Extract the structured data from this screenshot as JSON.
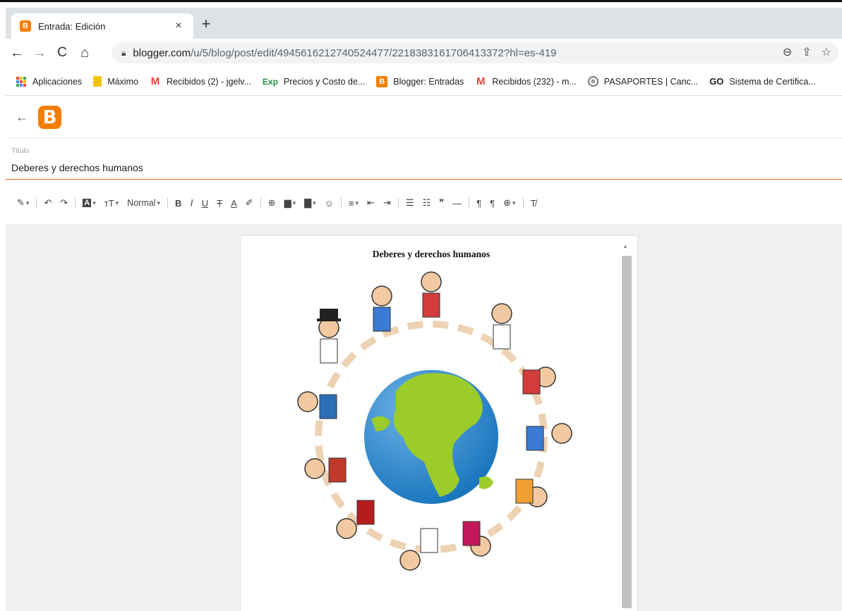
{
  "browser": {
    "tab": {
      "title": "Entrada: Edición",
      "favicon_letter": "B",
      "close": "×"
    },
    "new_tab": "+",
    "nav": {
      "back": "←",
      "forward": "→",
      "reload": "C",
      "home": "⌂"
    },
    "url": {
      "host": "blogger.com",
      "path": "/u/5/blog/post/edit/4945616212740524477/2218383161706413372?hl=es-419"
    },
    "omni_icons": {
      "zoom": "⊖",
      "share": "⇪",
      "star": "☆"
    }
  },
  "bookmarks": [
    {
      "icon": "apps-icon",
      "label": "Aplicaciones"
    },
    {
      "icon": "doc-icon",
      "label": "Máximo"
    },
    {
      "icon": "gmail-icon",
      "glyph": "M",
      "label": "Recibidos (2) - jgelv..."
    },
    {
      "icon": "exp-icon",
      "glyph": "Exp",
      "label": "Precios y Costo de..."
    },
    {
      "icon": "blogger-icon",
      "glyph": "B",
      "label": "Blogger: Entradas"
    },
    {
      "icon": "gmail-icon",
      "glyph": "M",
      "label": "Recibidos (232) - m..."
    },
    {
      "icon": "seal-icon",
      "glyph": "⊛",
      "label": "PASAPORTES | Canc..."
    },
    {
      "icon": "go-icon",
      "glyph": "GO",
      "label": "Sistema de Certifica..."
    }
  ],
  "app": {
    "back": "←",
    "logo_letter": "B",
    "title_label": "Título",
    "title_value": "Deberes y derechos humanos"
  },
  "format_bar": {
    "pen": "✎",
    "undo": "↶",
    "redo": "↷",
    "text_style": "A",
    "font_size": "тT",
    "paragraph": "Normal",
    "bold": "B",
    "italic": "I",
    "underline": "U",
    "strike": "T",
    "text_color": "A",
    "highlight": "✐",
    "link": "⊕",
    "image": "▆",
    "video": "▇",
    "emoji": "☺",
    "align": "≡",
    "indent_less": "⇤",
    "indent_more": "⇥",
    "bullets": "☰",
    "numbered": "☷",
    "quote": "❞",
    "hr": "—",
    "ltr": "¶",
    "rtl": "¶",
    "language": "⊕",
    "clear": "T̸",
    "caret": "▾"
  },
  "post": {
    "heading": "Deberes y derechos humanos"
  },
  "colors": {
    "blogger_orange": "#f57d00",
    "title_underline": "#e8622a",
    "globe_ocean": "#1e88d8",
    "globe_land": "#9ccc2a"
  }
}
